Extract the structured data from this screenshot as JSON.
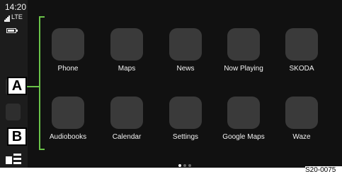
{
  "status_bar": {
    "time": "14:20",
    "network": "LTE"
  },
  "apps": [
    {
      "label": "Phone"
    },
    {
      "label": "Maps"
    },
    {
      "label": "News"
    },
    {
      "label": "Now Playing"
    },
    {
      "label": "SKODA"
    },
    {
      "label": "Audiobooks"
    },
    {
      "label": "Calendar"
    },
    {
      "label": "Settings"
    },
    {
      "label": "Google Maps"
    },
    {
      "label": "Waze"
    }
  ],
  "callouts": {
    "a": "A",
    "b": "B"
  },
  "pagination": {
    "pages": 3,
    "current": 1
  },
  "figure_id": "S20-0075",
  "colors": {
    "bracket": "#6bc44a",
    "tile": "#3a3a3a",
    "screen": "#111111"
  }
}
